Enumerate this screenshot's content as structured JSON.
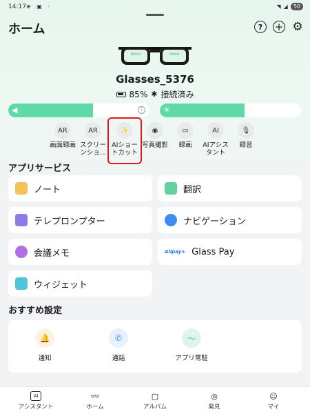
{
  "status_bar": {
    "time": "14:17",
    "left_icons": "⊕ ▣ ⋅",
    "battery": "50"
  },
  "header": {
    "title": "ホーム",
    "help_icon": "?",
    "add_icon": "+",
    "settings_icon": "⚙"
  },
  "glasses_image": {
    "frame_text": "Rokid"
  },
  "device": {
    "name": "Glasses_5376",
    "battery_pct": "85%",
    "connection": "接続済み"
  },
  "sliders": {
    "volume_level": 0.6,
    "brightness_level": 0.6
  },
  "shortcuts": [
    {
      "label": "画面録画",
      "icon": "AR"
    },
    {
      "label": "スクリー\nンショ...",
      "icon": "AR"
    },
    {
      "label": "AIショー\nトカット",
      "icon": "✨"
    },
    {
      "label": "写真撮影",
      "icon": "◉"
    },
    {
      "label": "録画",
      "icon": "▭"
    },
    {
      "label": "AIアシス\nタント",
      "icon": "AI"
    },
    {
      "label": "録音",
      "icon": "🎙"
    }
  ],
  "app_services": {
    "title": "アプリサービス",
    "cards": [
      {
        "label": "ノート",
        "color": "#f2c45a"
      },
      {
        "label": "翻訳",
        "color": "#5fd2a0"
      },
      {
        "label": "テレプロンプター",
        "color": "#8d7bea"
      },
      {
        "label": "ナビゲーション",
        "color": "#3f8cf0"
      },
      {
        "label": "会議メモ",
        "color": "#b36ee6"
      },
      {
        "label": "Glass Pay",
        "brand": "Alipay+",
        "color": "#1677ff"
      },
      {
        "label": "ウィジェット",
        "color": "#4fc6d8"
      }
    ]
  },
  "recommended": {
    "title": "おすすめ設定",
    "items": [
      {
        "label": "通知",
        "icon": "🔔",
        "color": "#f6a93b"
      },
      {
        "label": "通話",
        "icon": "✆",
        "color": "#3f8cf0"
      },
      {
        "label": "アプリ常駐",
        "icon": "〜",
        "color": "#39c27e"
      }
    ]
  },
  "bottom_nav": [
    {
      "label": "アシスタント",
      "icon": "AI"
    },
    {
      "label": "ホーム",
      "icon": "👓"
    },
    {
      "label": "アルバム",
      "icon": "▢"
    },
    {
      "label": "発見",
      "icon": "◎"
    },
    {
      "label": "マイ",
      "icon": "☺"
    }
  ]
}
